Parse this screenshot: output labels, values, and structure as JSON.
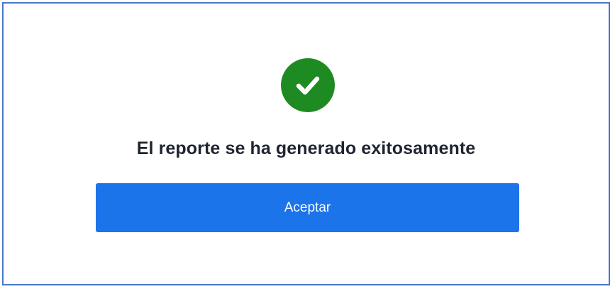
{
  "dialog": {
    "icon": "check-circle-icon",
    "message": "El reporte se ha generado exitosamente",
    "accept_label": "Aceptar"
  },
  "colors": {
    "success": "#1e8a22",
    "button": "#1b74e9",
    "text": "#1f2530",
    "border": "#4a78c8"
  }
}
